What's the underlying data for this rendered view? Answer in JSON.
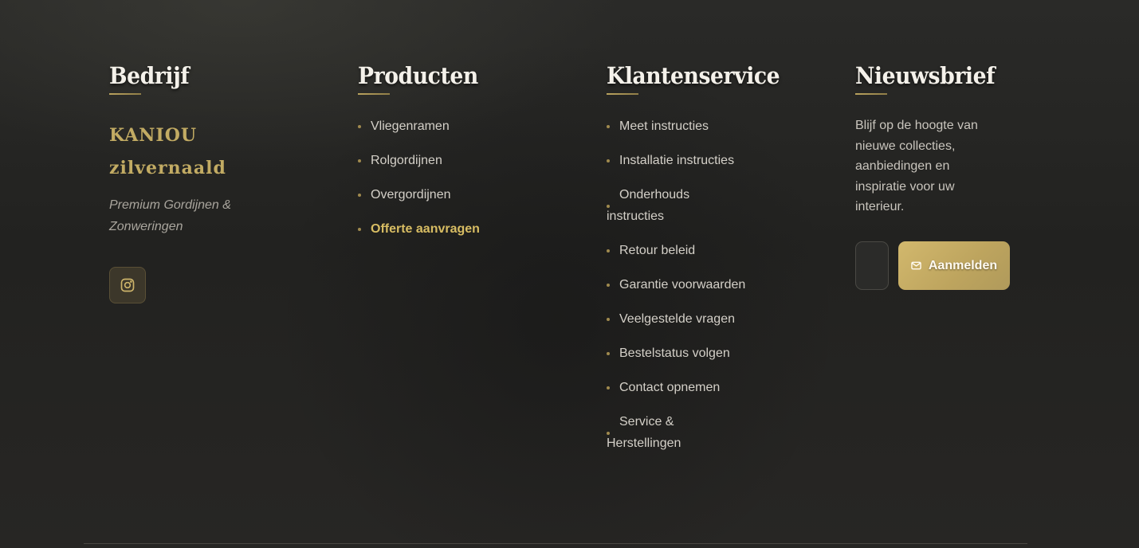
{
  "company": {
    "heading": "Bedrijf",
    "brand_line1": "KANIOU",
    "brand_line2": "zilvernaald",
    "tagline": "Premium Gordijnen & Zonweringen",
    "social_icon": "instagram-icon"
  },
  "products": {
    "heading": "Producten",
    "items": [
      {
        "label": "Vliegenramen"
      },
      {
        "label": "Rolgordijnen"
      },
      {
        "label": "Overgordijnen"
      },
      {
        "label": "Offerte aanvragen"
      }
    ]
  },
  "customer_service": {
    "heading": "Klantenservice",
    "items": [
      {
        "label": "Meet instructies"
      },
      {
        "label": "Installatie instructies"
      },
      {
        "label": "Onderhouds instructies"
      },
      {
        "label": "Retour beleid"
      },
      {
        "label": "Garantie voorwaarden"
      },
      {
        "label": "Veelgestelde vragen"
      },
      {
        "label": "Bestelstatus volgen"
      },
      {
        "label": "Contact opnemen"
      },
      {
        "label": "Service & Herstellingen"
      }
    ]
  },
  "newsletter": {
    "heading": "Nieuwsbrief",
    "text": "Blijf op de hoogte van nieuwe collecties, aanbiedingen en inspiratie voor uw interieur.",
    "button_label": "Aanmelden",
    "button_icon": "mail-icon"
  },
  "colors": {
    "accent_gold": "#c2ab63",
    "background": "#242422"
  }
}
